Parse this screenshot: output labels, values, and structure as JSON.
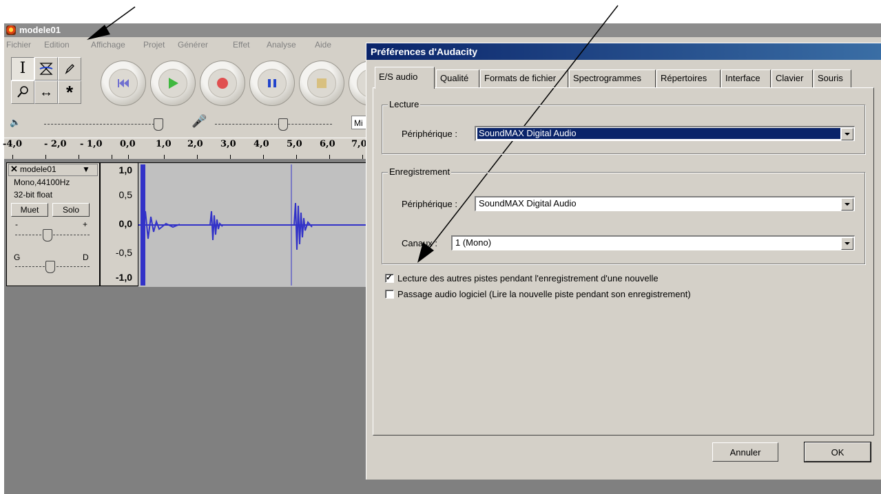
{
  "main_window": {
    "title": "modele01",
    "menu": [
      "Fichier",
      "Edition",
      "Affichage",
      "Projet",
      "Générer",
      "Effet",
      "Analyse",
      "Aide"
    ],
    "ruler_labels": [
      "-4,0",
      "- 2,0",
      "- 1,0",
      "0,0",
      "1,0",
      "2,0",
      "3,0",
      "4,0",
      "5,0",
      "6,0",
      "7,0"
    ],
    "mixer_input_source_truncated": "Mi",
    "track": {
      "name": "modele01",
      "format_line1": "Mono,44100Hz",
      "format_line2": "32-bit float",
      "mute_label": "Muet",
      "solo_label": "Solo",
      "gain_minus": "-",
      "gain_plus": "+",
      "pan_left": "G",
      "pan_right": "D",
      "scale": [
        "1,0",
        "0,5",
        "0,0",
        "-0,5",
        "-1,0"
      ]
    }
  },
  "dialog": {
    "title": "Préférences d'Audacity",
    "tabs": [
      "E/S audio",
      "Qualité",
      "Formats de fichier",
      "Spectrogrammes",
      "Répertoires",
      "Interface",
      "Clavier",
      "Souris"
    ],
    "active_tab": "E/S audio",
    "playback_group": {
      "title": "Lecture",
      "device_label": "Périphérique :",
      "device_value": "SoundMAX Digital Audio"
    },
    "recording_group": {
      "title": "Enregistrement",
      "device_label": "Périphérique :",
      "device_value": "SoundMAX Digital Audio",
      "channels_label": "Canaux :",
      "channels_value": "1 (Mono)"
    },
    "options": [
      {
        "label": "Lecture des autres pistes pendant l'enregistrement d'une nouvelle",
        "checked": true
      },
      {
        "label": "Passage audio logiciel (Lire la nouvelle piste pendant son enregistrement)",
        "checked": false
      }
    ],
    "cancel_label": "Annuler",
    "ok_label": "OK"
  },
  "colors": {
    "title_bar_active": "#0a246a",
    "waveform": "#3232c8",
    "window_face": "#d4d0c8",
    "workspace": "#808080"
  }
}
